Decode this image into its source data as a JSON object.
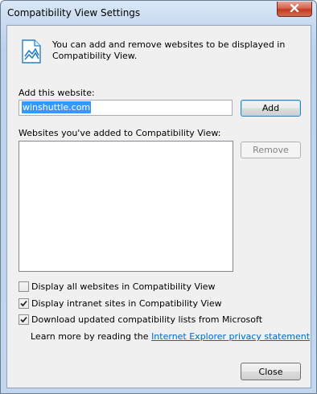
{
  "window": {
    "title": "Compatibility View Settings"
  },
  "info": {
    "icon": "compatibility-view-icon",
    "text": "You can add and remove websites to be displayed in Compatibility View."
  },
  "add_section": {
    "label": "Add this website:",
    "input_value": "winshuttle.com",
    "add_button": "Add"
  },
  "list_section": {
    "label": "Websites you've added to Compatibility View:",
    "remove_button": "Remove",
    "items": []
  },
  "options": [
    {
      "label": "Display all websites in Compatibility View",
      "checked": false
    },
    {
      "label": "Display intranet sites in Compatibility View",
      "checked": true
    },
    {
      "label": "Download updated compatibility lists from Microsoft",
      "checked": true
    }
  ],
  "learn_more": {
    "prefix": "Learn more by reading the",
    "link_text": "Internet Explorer privacy statement"
  },
  "footer": {
    "close_button": "Close"
  },
  "colors": {
    "link": "#0066cc",
    "selection": "#3399ff",
    "close_button_red": "#c23a1f"
  }
}
